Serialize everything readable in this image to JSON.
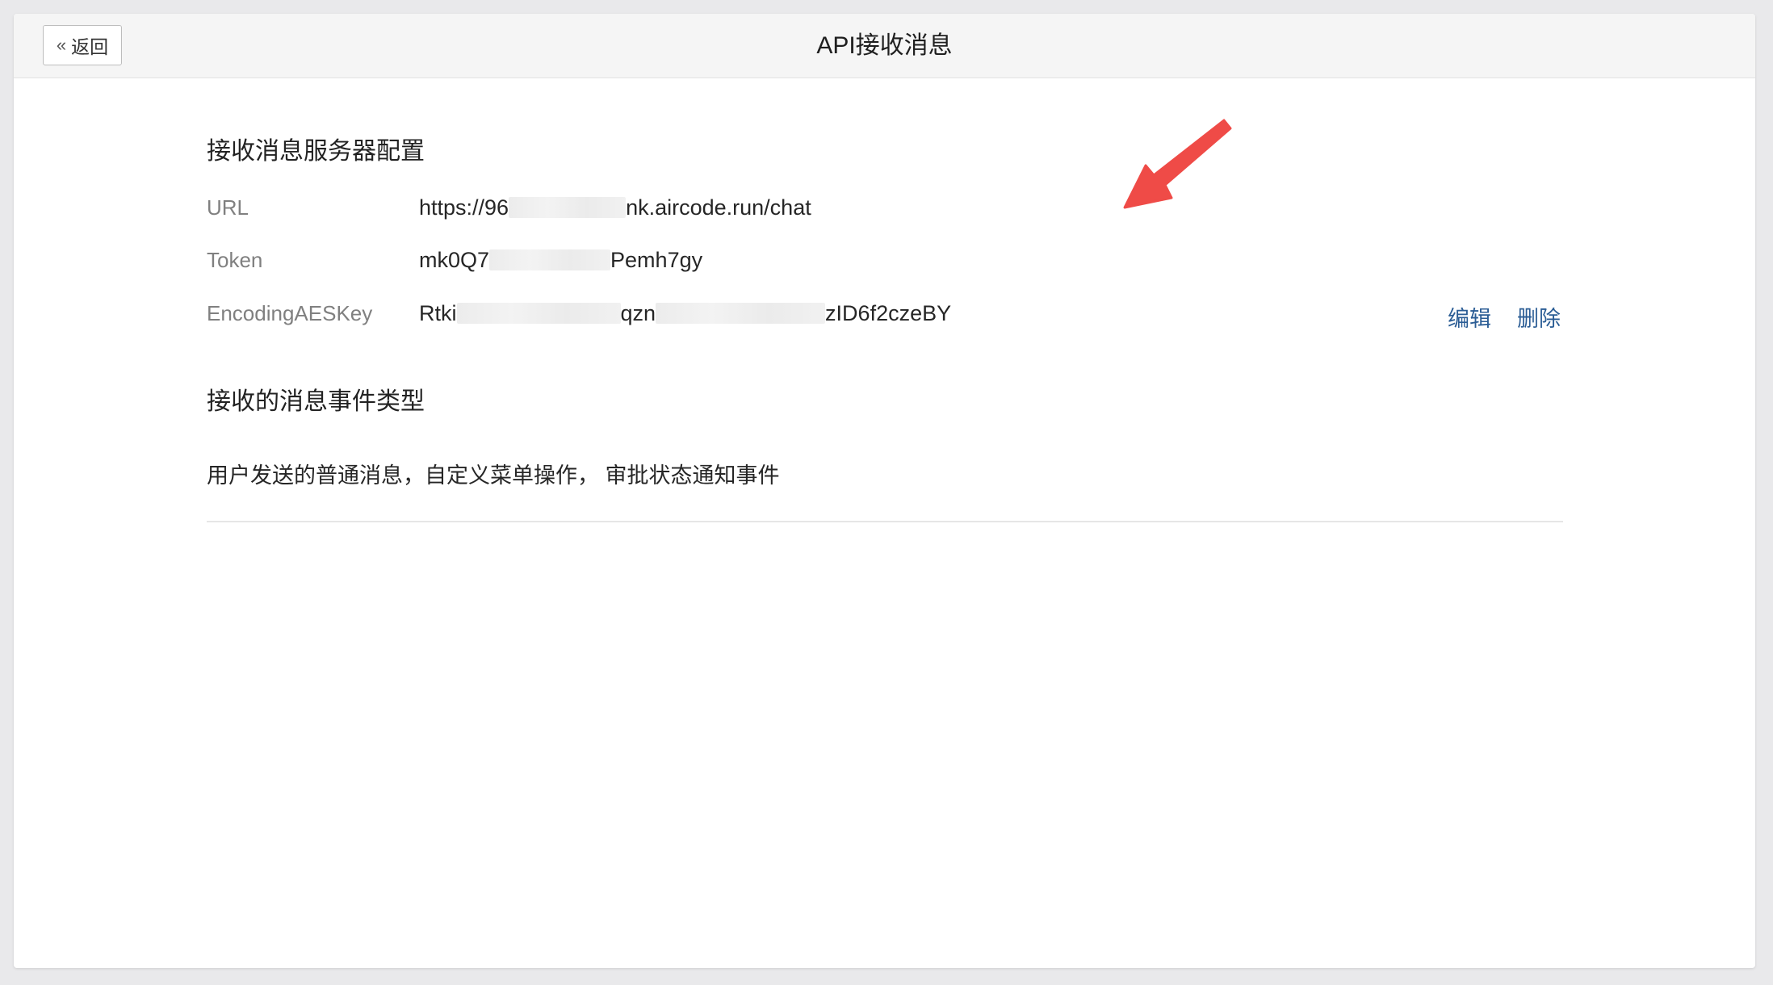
{
  "header": {
    "back_label": "返回",
    "title": "API接收消息"
  },
  "config": {
    "section_title": "接收消息服务器配置",
    "rows": [
      {
        "label": "URL",
        "value_start": "https://96",
        "value_end": "nk.aircode.run/chat"
      },
      {
        "label": "Token",
        "value_start": "mk0Q7",
        "value_end": "Pemh7gy"
      },
      {
        "label": "EncodingAESKey",
        "value_start": "Rtki",
        "value_mid": "qzn",
        "value_end": "zID6f2czeBY"
      }
    ],
    "edit_label": "编辑",
    "delete_label": "删除"
  },
  "events": {
    "section_title": "接收的消息事件类型",
    "description": "用户发送的普通消息，自定义菜单操作， 审批状态通知事件"
  },
  "colors": {
    "link": "#2b5d95",
    "annotation_arrow": "#ef4b47"
  },
  "icons": {
    "back": "double-chevron-left-icon",
    "annotation": "red-arrow-icon"
  }
}
